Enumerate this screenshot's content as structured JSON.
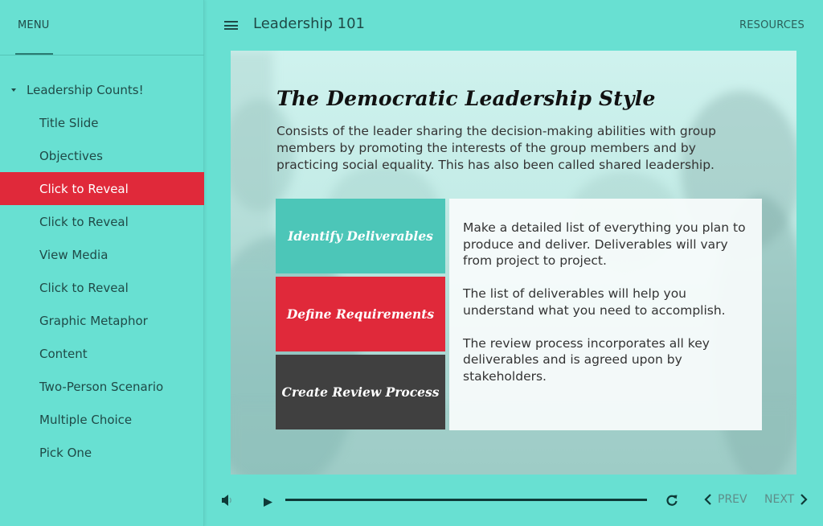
{
  "sidebar": {
    "menu_tab": "MENU",
    "section": "Leadership Counts!",
    "items": [
      {
        "label": "Title Slide",
        "active": false
      },
      {
        "label": "Objectives",
        "active": false
      },
      {
        "label": "Click to Reveal",
        "active": true
      },
      {
        "label": "Click to Reveal",
        "active": false
      },
      {
        "label": "View Media",
        "active": false
      },
      {
        "label": "Click to Reveal",
        "active": false
      },
      {
        "label": "Graphic Metaphor",
        "active": false
      },
      {
        "label": "Content",
        "active": false
      },
      {
        "label": "Two-Person Scenario",
        "active": false
      },
      {
        "label": "Multiple Choice",
        "active": false
      },
      {
        "label": "Pick One",
        "active": false
      }
    ]
  },
  "header": {
    "menu_icon": "hamburger-icon",
    "title": "Leadership 101",
    "resources": "RESOURCES"
  },
  "slide": {
    "title": "The Democratic Leadership Style",
    "body": "Consists of the leader sharing the decision-making abilities with group members by promoting the interests of the group members and by practicing social equality. This has also been called shared leadership.",
    "tabs": [
      {
        "label": "Identify Deliverables",
        "color": "#4cc6b8"
      },
      {
        "label": "Define Requirements",
        "color": "#e0293a"
      },
      {
        "label": "Create Review Process",
        "color": "#404040"
      }
    ],
    "content": [
      "Make a detailed list of everything you plan to produce and deliver. Deliverables will vary from project to project.",
      "The list of deliverables will help you understand what you need to accomplish.",
      "The review process incorporates all key deliverables and is agreed upon by stakeholders."
    ]
  },
  "player": {
    "volume_icon": "volume-icon",
    "play_icon": "play-icon",
    "progress": 1.0,
    "replay_icon": "replay-icon",
    "prev_label": "PREV",
    "next_label": "NEXT"
  },
  "colors": {
    "background": "#68e0d2",
    "accent_red": "#e0293a",
    "teal_tab": "#4cc6b8",
    "dark_tab": "#404040",
    "text_dark": "#1f4a47"
  }
}
